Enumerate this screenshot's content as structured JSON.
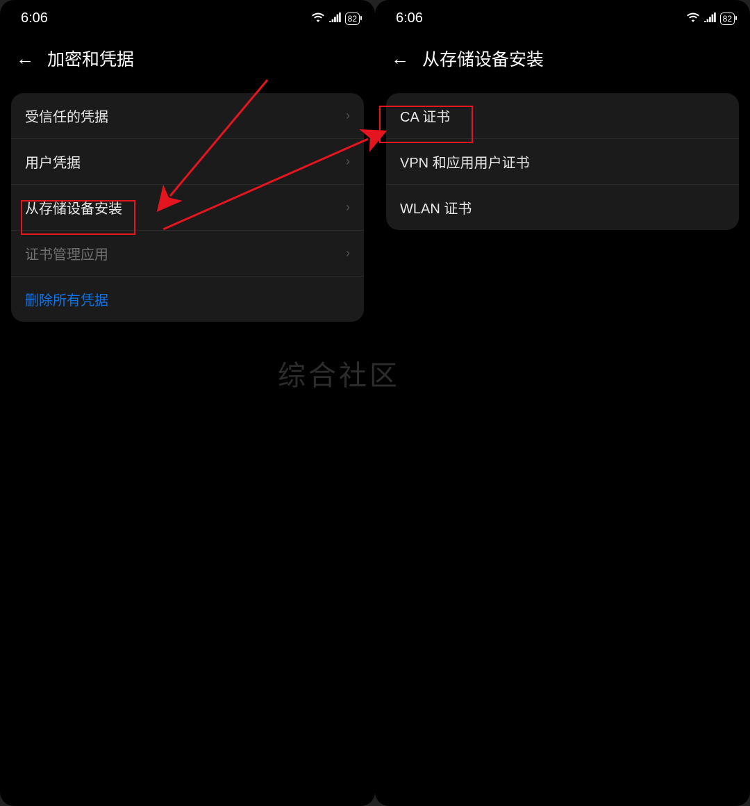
{
  "status": {
    "time": "6:06",
    "battery": "82"
  },
  "left": {
    "title": "加密和凭据",
    "rows": [
      {
        "label": "受信任的凭据",
        "chevron": true
      },
      {
        "label": "用户凭据",
        "chevron": true
      },
      {
        "label": "从存储设备安装",
        "chevron": true
      },
      {
        "label": "证书管理应用",
        "chevron": true,
        "dim": true
      },
      {
        "label": "删除所有凭据",
        "link": true
      }
    ]
  },
  "right": {
    "title": "从存储设备安装",
    "rows": [
      {
        "label": "CA 证书"
      },
      {
        "label": "VPN 和应用用户证书"
      },
      {
        "label": "WLAN 证书"
      }
    ]
  },
  "watermark": "综合社区"
}
